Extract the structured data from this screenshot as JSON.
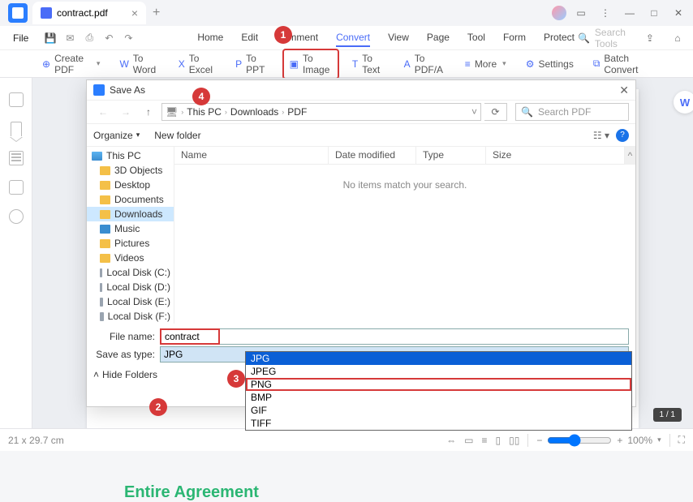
{
  "tab": {
    "title": "contract.pdf"
  },
  "menu": {
    "file": "File",
    "items": [
      "Home",
      "Edit",
      "Comment",
      "Convert",
      "View",
      "Page",
      "Tool",
      "Form",
      "Protect"
    ],
    "active": "Convert",
    "search_placeholder": "Search Tools"
  },
  "toolbar": {
    "create": "Create PDF",
    "to_word": "To Word",
    "to_excel": "To Excel",
    "to_ppt": "To PPT",
    "to_image": "To Image",
    "to_text": "To Text",
    "to_pdfa": "To PDF/A",
    "more": "More",
    "settings": "Settings",
    "batch": "Batch Convert"
  },
  "document": {
    "heading": "Entire Agreement"
  },
  "dialog": {
    "title": "Save As",
    "path": [
      "This PC",
      "Downloads",
      "PDF"
    ],
    "search_placeholder": "Search PDF",
    "organize": "Organize",
    "new_folder": "New folder",
    "columns": {
      "name": "Name",
      "date": "Date modified",
      "type": "Type",
      "size": "Size"
    },
    "empty": "No items match your search.",
    "tree": [
      "This PC",
      "3D Objects",
      "Desktop",
      "Documents",
      "Downloads",
      "Music",
      "Pictures",
      "Videos",
      "Local Disk (C:)",
      "Local Disk (D:)",
      "Local Disk (E:)",
      "Local Disk (F:)"
    ],
    "tree_selected": "Downloads",
    "file_name_label": "File name:",
    "file_name_value": "contract",
    "save_type_label": "Save as type:",
    "save_type_value": "JPG",
    "type_options": [
      "JPG",
      "JPEG",
      "PNG",
      "BMP",
      "GIF",
      "TIFF"
    ],
    "type_selected": "JPG",
    "hide_folders": "Hide Folders"
  },
  "status": {
    "dims": "21 x 29.7 cm",
    "zoom": "100%",
    "page": "1 / 1"
  },
  "callouts": {
    "1": "1",
    "2": "2",
    "3": "3",
    "4": "4"
  }
}
